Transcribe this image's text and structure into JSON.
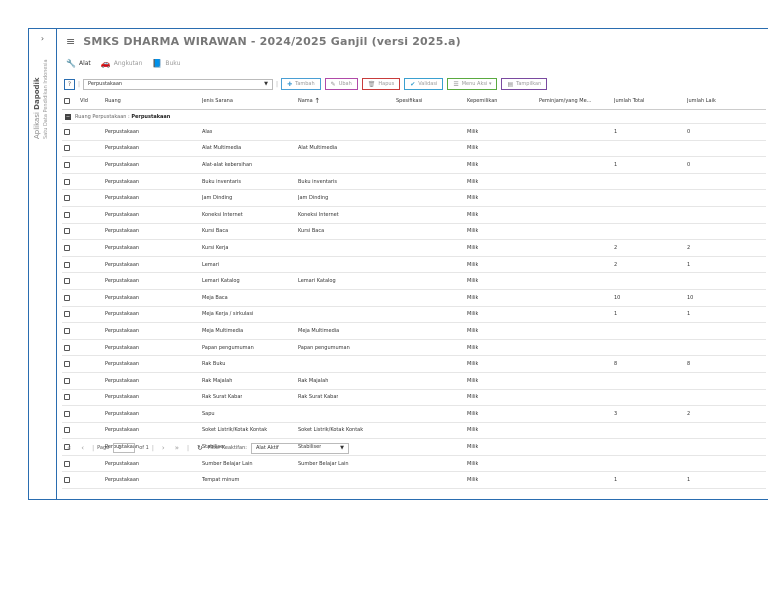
{
  "sidebar": {
    "toggle": "›",
    "app_prefix": "Aplikasi",
    "app_name": "Dapodik",
    "subtitle": "Satu Data Pendidikan Indonesia"
  },
  "header": {
    "title": "SMKS DHARMA WIRAWAN - 2024/2025 Ganjil (versi 2025.a)"
  },
  "tabs": [
    {
      "label": "Alat"
    },
    {
      "label": "Angkutan"
    },
    {
      "label": "Buku"
    }
  ],
  "toolbar": {
    "help": "?",
    "ruang_value": "Perpustakaan",
    "tambah": "Tambah",
    "ubah": "Ubah",
    "hapus": "Hapus",
    "validasi": "Validasi",
    "menu_aksi": "Menu Aksi",
    "tampilkan": "Tampilkan"
  },
  "columns": {
    "vld": "Vld",
    "ruang": "Ruang",
    "jenis": "Jenis Sarana",
    "nama": "Nama",
    "sort_icon": "↑",
    "spesifikasi": "Spesifikasi",
    "kepemilikan": "Kepemilikan",
    "peminjam": "Peminjam/yang Me...",
    "total": "Jumlah Total",
    "laik": "Jumlah Laik"
  },
  "group": {
    "prefix": "Ruang Perpustakaan :",
    "name": "Perpustakaan"
  },
  "rows": [
    {
      "ruang": "Perpustakaan",
      "jenis": "Alas",
      "nama": "",
      "spek": "",
      "kepemilikan": "Milik",
      "peminjam": "",
      "total": "1",
      "laik": "0"
    },
    {
      "ruang": "Perpustakaan",
      "jenis": "Alat Multimedia",
      "nama": "Alat Multimedia",
      "spek": "",
      "kepemilikan": "Milik",
      "peminjam": "",
      "total": "",
      "laik": ""
    },
    {
      "ruang": "Perpustakaan",
      "jenis": "Alat-alat kebersihan",
      "nama": "",
      "spek": "",
      "kepemilikan": "Milik",
      "peminjam": "",
      "total": "1",
      "laik": "0"
    },
    {
      "ruang": "Perpustakaan",
      "jenis": "Buku inventaris",
      "nama": "Buku inventaris",
      "spek": "",
      "kepemilikan": "Milik",
      "peminjam": "",
      "total": "",
      "laik": ""
    },
    {
      "ruang": "Perpustakaan",
      "jenis": "Jam Dinding",
      "nama": "Jam Dinding",
      "spek": "",
      "kepemilikan": "Milik",
      "peminjam": "",
      "total": "",
      "laik": ""
    },
    {
      "ruang": "Perpustakaan",
      "jenis": "Koneksi Internet",
      "nama": "Koneksi Internet",
      "spek": "",
      "kepemilikan": "Milik",
      "peminjam": "",
      "total": "",
      "laik": ""
    },
    {
      "ruang": "Perpustakaan",
      "jenis": "Kursi Baca",
      "nama": "Kursi Baca",
      "spek": "",
      "kepemilikan": "Milik",
      "peminjam": "",
      "total": "",
      "laik": ""
    },
    {
      "ruang": "Perpustakaan",
      "jenis": "Kursi Kerja",
      "nama": "",
      "spek": "",
      "kepemilikan": "Milik",
      "peminjam": "",
      "total": "2",
      "laik": "2"
    },
    {
      "ruang": "Perpustakaan",
      "jenis": "Lemari",
      "nama": "",
      "spek": "",
      "kepemilikan": "Milik",
      "peminjam": "",
      "total": "2",
      "laik": "1"
    },
    {
      "ruang": "Perpustakaan",
      "jenis": "Lemari Katalog",
      "nama": "Lemari Katalog",
      "spek": "",
      "kepemilikan": "Milik",
      "peminjam": "",
      "total": "",
      "laik": ""
    },
    {
      "ruang": "Perpustakaan",
      "jenis": "Meja Baca",
      "nama": "",
      "spek": "",
      "kepemilikan": "Milik",
      "peminjam": "",
      "total": "10",
      "laik": "10"
    },
    {
      "ruang": "Perpustakaan",
      "jenis": "Meja Kerja / sirkulasi",
      "nama": "",
      "spek": "",
      "kepemilikan": "Milik",
      "peminjam": "",
      "total": "1",
      "laik": "1"
    },
    {
      "ruang": "Perpustakaan",
      "jenis": "Meja Multimedia",
      "nama": "Meja Multimedia",
      "spek": "",
      "kepemilikan": "Milik",
      "peminjam": "",
      "total": "",
      "laik": ""
    },
    {
      "ruang": "Perpustakaan",
      "jenis": "Papan pengumuman",
      "nama": "Papan pengumuman",
      "spek": "",
      "kepemilikan": "Milik",
      "peminjam": "",
      "total": "",
      "laik": ""
    },
    {
      "ruang": "Perpustakaan",
      "jenis": "Rak Buku",
      "nama": "",
      "spek": "",
      "kepemilikan": "Milik",
      "peminjam": "",
      "total": "8",
      "laik": "8"
    },
    {
      "ruang": "Perpustakaan",
      "jenis": "Rak Majalah",
      "nama": "Rak Majalah",
      "spek": "",
      "kepemilikan": "Milik",
      "peminjam": "",
      "total": "",
      "laik": ""
    },
    {
      "ruang": "Perpustakaan",
      "jenis": "Rak Surat Kabar",
      "nama": "Rak Surat Kabar",
      "spek": "",
      "kepemilikan": "Milik",
      "peminjam": "",
      "total": "",
      "laik": ""
    },
    {
      "ruang": "Perpustakaan",
      "jenis": "Sapu",
      "nama": "",
      "spek": "",
      "kepemilikan": "Milik",
      "peminjam": "",
      "total": "3",
      "laik": "2"
    },
    {
      "ruang": "Perpustakaan",
      "jenis": "Soket Listrik/Kotak Kontak",
      "nama": "Soket Listrik/Kotak Kontak",
      "spek": "",
      "kepemilikan": "Milik",
      "peminjam": "",
      "total": "",
      "laik": ""
    },
    {
      "ruang": "Perpustakaan",
      "jenis": "Stabiliser",
      "nama": "Stabiliser",
      "spek": "",
      "kepemilikan": "Milik",
      "peminjam": "",
      "total": "",
      "laik": ""
    },
    {
      "ruang": "Perpustakaan",
      "jenis": "Sumber Belajar Lain",
      "nama": "Sumber Belajar Lain",
      "spek": "",
      "kepemilikan": "Milik",
      "peminjam": "",
      "total": "",
      "laik": ""
    },
    {
      "ruang": "Perpustakaan",
      "jenis": "Tempat minum",
      "nama": "",
      "spek": "",
      "kepemilikan": "Milik",
      "peminjam": "",
      "total": "1",
      "laik": "1"
    }
  ],
  "pager": {
    "first": "«",
    "prev": "‹",
    "page_label": "Page",
    "page_value": "1",
    "of_label": "of 1",
    "next": "›",
    "last": "»",
    "refresh": "↻",
    "filter_label": "Filter Keaktifan:",
    "filter_value": "Alat Aktif"
  },
  "colors": {
    "frame_border": "#2a6db0",
    "accent": "#1a56a0"
  }
}
